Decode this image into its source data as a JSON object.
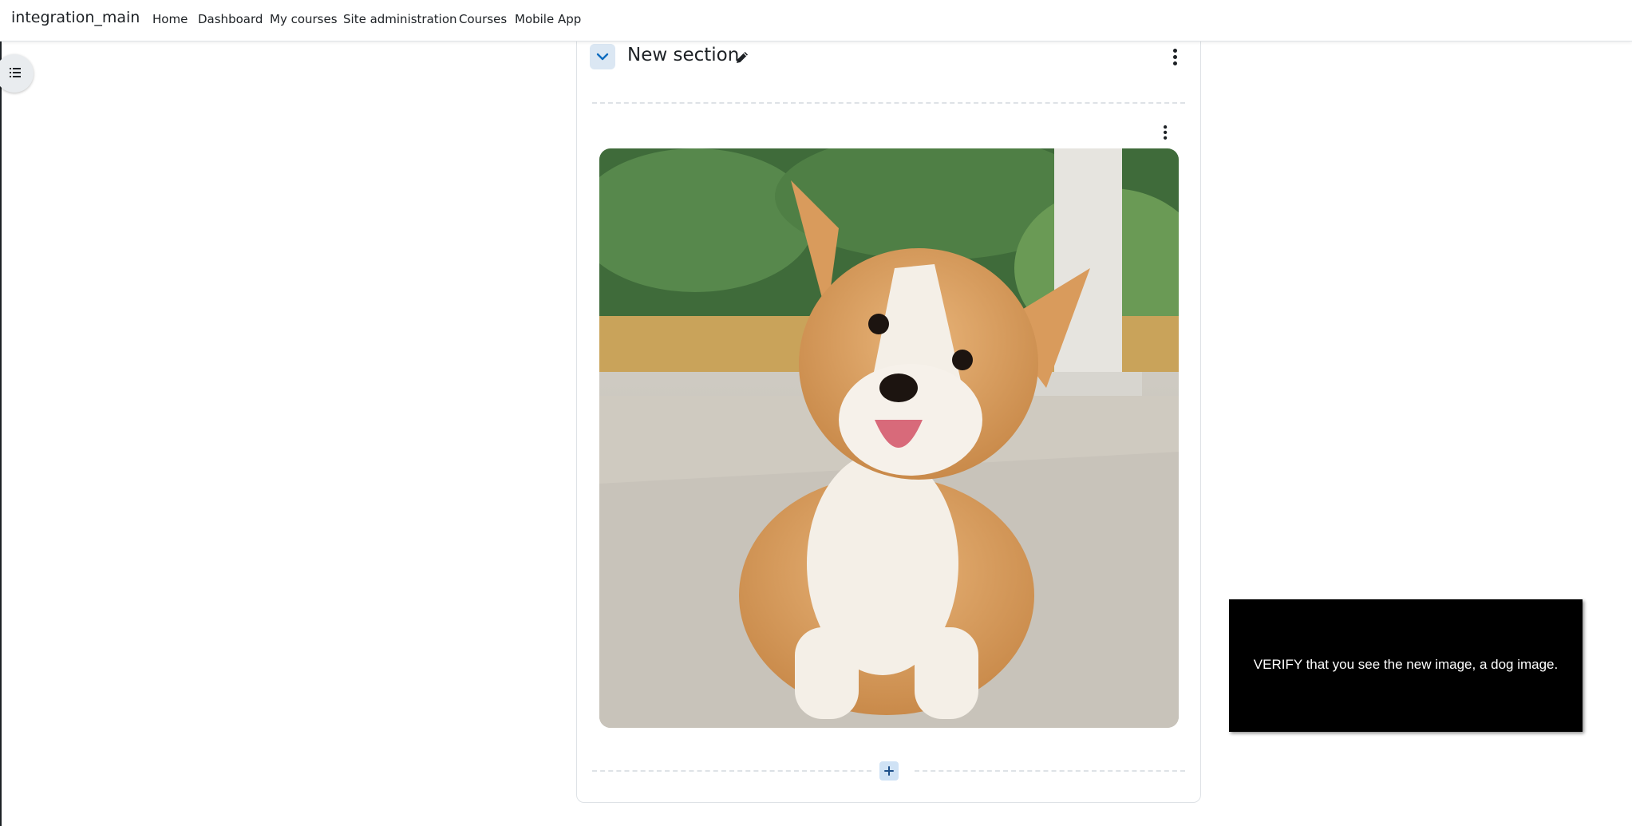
{
  "navbar": {
    "brand": "integration_main",
    "links": [
      "Home",
      "Dashboard",
      "My courses",
      "Site administration",
      "Courses",
      "Mobile App"
    ]
  },
  "section": {
    "title": "New section"
  },
  "notice": {
    "text": "VERIFY that you see the new image, a dog image."
  },
  "icons": {
    "drawer": "list-icon",
    "collapse": "chevron-down-icon",
    "edit": "pencil-icon",
    "menu": "kebab-menu-icon",
    "add": "plus-icon"
  },
  "colors": {
    "accent_light": "#dbe7f3",
    "add_button": "#cfe2f5",
    "notice_bg": "#000000"
  }
}
